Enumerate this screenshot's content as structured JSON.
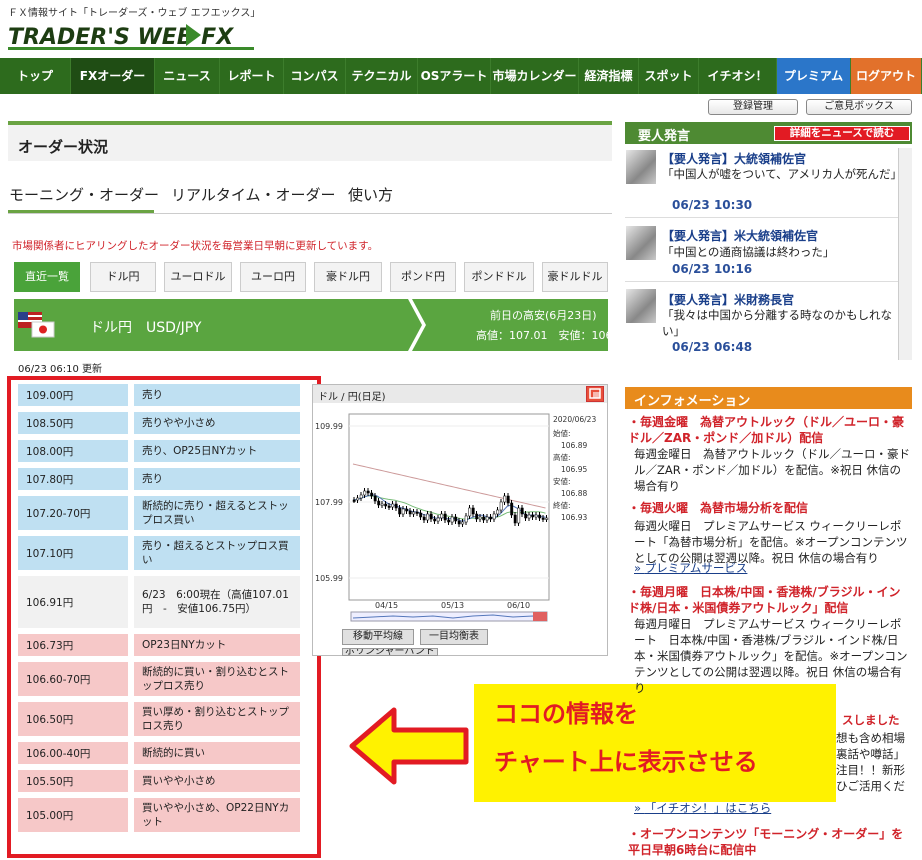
{
  "header": {
    "tagline": "ＦＸ情報サイト「トレーダーズ・ウェブ エフエックス」",
    "logo_text": "TRADER'S WEB FX"
  },
  "nav": {
    "items": [
      "トップ",
      "FXオーダー",
      "ニュース",
      "レポート",
      "コンパス",
      "テクニカル",
      "OSアラート",
      "市場カレンダー",
      "経済指標",
      "スポット",
      "イチオシ！"
    ],
    "premium": "プレミアム",
    "logout": "ログアウト"
  },
  "subnav": {
    "registration": "登録管理",
    "feedback": "ご意見ボックス"
  },
  "orders": {
    "title": "オーダー状況",
    "tabs": [
      "モーニング・オーダー",
      "リアルタイム・オーダー",
      "使い方"
    ],
    "notice": "市場関係者にヒアリングしたオーダー状況を毎営業日早朝に更新しています。",
    "pairs": [
      "直近一覧",
      "ドル円",
      "ユーロドル",
      "ユーロ円",
      "豪ドル円",
      "ポンド円",
      "ポンドドル",
      "豪ドルドル"
    ],
    "current_pair": "ドル円　USD/JPY",
    "prev_day_label": "前日の高安(6月23日)",
    "prev_day_values": "高値：107.01　安値：106.76",
    "updated": "06/23 06:10 更新",
    "rows": [
      {
        "price": "109.00円",
        "desc": "売り",
        "kind": "blue"
      },
      {
        "price": "108.50円",
        "desc": "売りやや小さめ",
        "kind": "blue"
      },
      {
        "price": "108.00円",
        "desc": "売り、OP25日NYカット",
        "kind": "blue"
      },
      {
        "price": "107.80円",
        "desc": "売り",
        "kind": "blue"
      },
      {
        "price": "107.20-70円",
        "desc": "断続的に売り・超えるとストップロス買い",
        "kind": "blue"
      },
      {
        "price": "107.10円",
        "desc": "売り・超えるとストップロス買い",
        "kind": "blue"
      },
      {
        "price": "106.91円",
        "desc": "6/23　6:00現在（高値107.01円　-　安値106.75円）",
        "kind": "gray"
      },
      {
        "price": "106.73円",
        "desc": "OP23日NYカット",
        "kind": "pink"
      },
      {
        "price": "106.60-70円",
        "desc": "断続的に買い・割り込むとストップロス売り",
        "kind": "pink"
      },
      {
        "price": "106.50円",
        "desc": "買い厚め・割り込むとストップロス売り",
        "kind": "pink"
      },
      {
        "price": "106.00-40円",
        "desc": "断続的に買い",
        "kind": "pink"
      },
      {
        "price": "105.50円",
        "desc": "買いやや小さめ",
        "kind": "pink"
      },
      {
        "price": "105.00円",
        "desc": "買いやや小さめ、OP22日NYカット",
        "kind": "pink"
      }
    ]
  },
  "chart": {
    "title": "ドル / 円(日足)",
    "date": "2020/06/23",
    "y_ticks": [
      "109.99",
      "107.99",
      "105.99"
    ],
    "x_ticks": [
      "04/15",
      "05/13",
      "06/10"
    ],
    "ohlc_labels": [
      "始値:",
      "106.89",
      "高値:",
      "106.95",
      "安値:",
      "106.88",
      "終値:",
      "106.93"
    ],
    "buttons": [
      "移動平均線",
      "一目均衡表"
    ],
    "button_partial": "ボリンジャーバンド"
  },
  "callout": {
    "line1": "ココの情報を",
    "line2": "チャート上に表示させる"
  },
  "vip": {
    "title": "要人発言",
    "button": "詳細をニュースで読む",
    "items": [
      {
        "title": "【要人発言】大統領補佐官",
        "desc": "「中国人が嘘をついて、アメリカ人が死んだ」",
        "time": "06/23 10:30"
      },
      {
        "title": "【要人発言】米大統領補佐官",
        "desc": "「中国との通商協議は終わった」",
        "time": "06/23 10:16"
      },
      {
        "title": "【要人発言】米財務長官",
        "desc": "「我々は中国から分離する時なのかもしれない」",
        "time": "06/23 06:48"
      }
    ]
  },
  "info": {
    "title": "インフォメーション",
    "items": [
      {
        "head": "毎週金曜　為替アウトルック（ドル／ユーロ・豪ドル／ZAR・ポンド／加ドル）配信",
        "body": "毎週金曜日　為替アウトルック（ドル／ユーロ・豪ドル／ZAR・ポンド／加ドル）を配信。※祝日 休信の場合有り"
      },
      {
        "head": "毎週火曜　為替市場分析を配信",
        "body": "毎週火曜日　プレミアムサービス ウィークリーレポート「為替市場分析」を配信。※オープンコンテンツとしての公開は翌週以降。祝日 休信の場合有り",
        "link": "プレミアムサービス"
      },
      {
        "head": "毎週月曜　日本株/中国・香港株/ブラジル・インド株/日本・米国債券アウトルック」配信",
        "body": "毎週月曜日　プレミアムサービス ウィークリーレポート　日本株/中国・香港株/ブラジル・インド株/日本・米国債券アウトルック」を配信。※オープンコンテンツとしての公開は翌週以降。祝日 休信の場合有り"
      }
    ],
    "partial_lines": [
      "スしました",
      "想も含め相場",
      "裏話や噂話」",
      "注目！！新形",
      "ひご活用くだ"
    ],
    "ichioshi_link": "「イチオシ！」はこちら",
    "last_head": "オープンコンテンツ「モーニング・オーダー」を平日早朝6時台に配信中"
  }
}
